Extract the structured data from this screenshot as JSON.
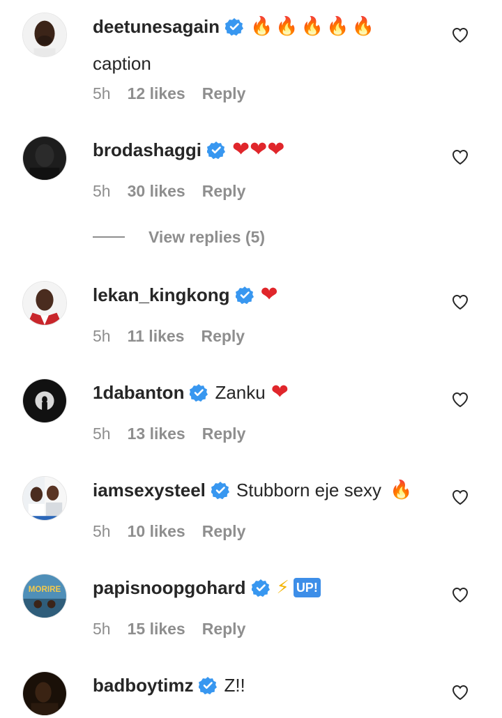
{
  "comments": [
    {
      "username": "deetunesagain",
      "emoji": "🔥🔥🔥🔥🔥",
      "text": "",
      "caption": "caption",
      "time": "5h",
      "likes": "12 likes",
      "reply": "Reply"
    },
    {
      "username": "brodashaggi",
      "emoji": "❤❤❤",
      "text": "",
      "time": "5h",
      "likes": "30 likes",
      "reply": "Reply",
      "view_replies": "View replies (5)"
    },
    {
      "username": "lekan_kingkong",
      "emoji": "❤",
      "text": "",
      "time": "5h",
      "likes": "11 likes",
      "reply": "Reply"
    },
    {
      "username": "1dabanton",
      "text": "Zanku",
      "emoji": "❤",
      "time": "5h",
      "likes": "13 likes",
      "reply": "Reply"
    },
    {
      "username": "iamsexysteel",
      "text": "Stubborn eje sexy",
      "emoji": "🔥",
      "time": "5h",
      "likes": "10 likes",
      "reply": "Reply"
    },
    {
      "username": "papisnoopgohard",
      "emoji": "⚡",
      "badge": "UP!",
      "time": "5h",
      "likes": "15 likes",
      "reply": "Reply",
      "avatar_text": "MORIRE"
    },
    {
      "username": "badboytimz",
      "text": "Z!!",
      "time": "",
      "likes": "",
      "reply": ""
    }
  ],
  "colors": {
    "verified": "#3897f0",
    "muted": "#8e8e8e",
    "text": "#262626",
    "heart_emoji": "#e0262b",
    "fire_emoji": "#f28a0d"
  },
  "icons": {
    "verified": "verified-badge-icon",
    "like": "heart-outline-icon"
  }
}
